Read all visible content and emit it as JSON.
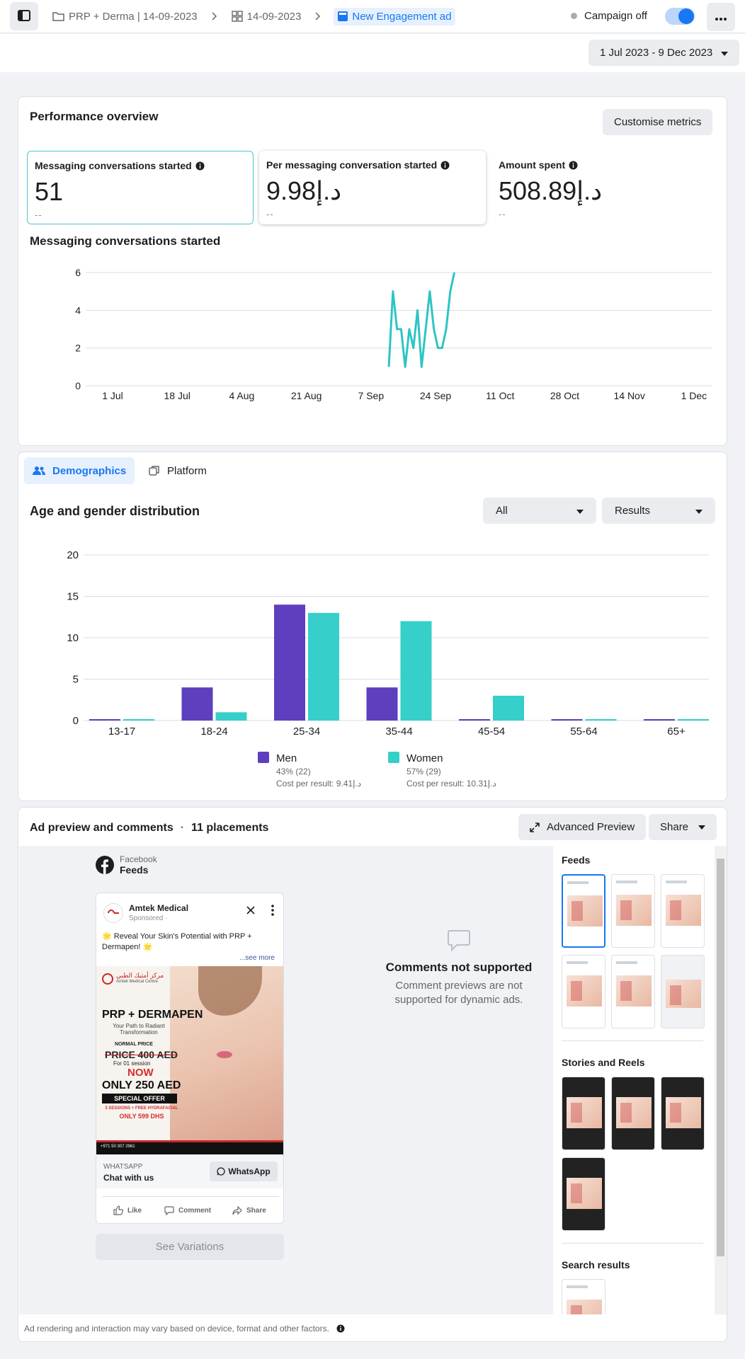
{
  "topbar": {
    "breadcrumbs": [
      "PRP + Derma | 14-09-2023",
      "14-09-2023",
      "New Engagement ad"
    ],
    "status_label": "Campaign off",
    "toggle_on": true
  },
  "date_range": "1 Jul 2023 - 9 Dec 2023",
  "performance": {
    "title": "Performance overview",
    "customise_label": "Customise metrics",
    "metrics": [
      {
        "label": "Messaging conversations started",
        "value": "51",
        "compare": "--"
      },
      {
        "label": "Per messaging conversation started",
        "value": "د.إ9.98",
        "compare": "--"
      },
      {
        "label": "Amount spent",
        "value": "د.إ508.89",
        "compare": "--"
      }
    ],
    "chart_title": "Messaging conversations started"
  },
  "line_chart": {
    "type": "line",
    "title": "Messaging conversations started",
    "x_tick_labels": [
      "1 Jul",
      "18 Jul",
      "4 Aug",
      "21 Aug",
      "7 Sep",
      "24 Sep",
      "11 Oct",
      "28 Oct",
      "14 Nov",
      "1 Dec"
    ],
    "y_ticks": [
      0,
      2,
      4,
      6
    ],
    "ylim": [
      0,
      6
    ],
    "x_day_range": [
      0,
      153
    ],
    "x_days": [
      74,
      75,
      76,
      77,
      78,
      79,
      80,
      81,
      82,
      83,
      84,
      85,
      86,
      87,
      88,
      89,
      90
    ],
    "values": [
      1,
      5,
      3,
      3,
      1,
      3,
      2,
      4,
      1,
      3,
      5,
      3,
      2,
      2,
      3,
      5,
      6
    ],
    "color": "#2ec4c4"
  },
  "demographics": {
    "tabs": [
      "Demographics",
      "Platform"
    ],
    "title": "Age and gender distribution",
    "filter_all": "All",
    "filter_results": "Results",
    "legend": [
      {
        "name": "Men",
        "share": "43% (22)",
        "cpr": "Cost per result: 9.41د.إ"
      },
      {
        "name": "Women",
        "share": "57% (29)",
        "cpr": "Cost per result: 10.31د.إ"
      }
    ]
  },
  "chart_data": {
    "type": "bar",
    "title": "Age and gender distribution",
    "categories": [
      "13-17",
      "18-24",
      "25-34",
      "35-44",
      "45-54",
      "55-64",
      "65+"
    ],
    "series": [
      {
        "name": "Men",
        "values": [
          0,
          4,
          14,
          4,
          0,
          0,
          0
        ],
        "color": "#5e3fbe"
      },
      {
        "name": "Women",
        "values": [
          0,
          1,
          13,
          12,
          3,
          0,
          0
        ],
        "color": "#36cfc9"
      }
    ],
    "y_ticks": [
      0,
      5,
      10,
      15,
      20
    ],
    "ylim": [
      0,
      20
    ],
    "legend_position": "bottom"
  },
  "ad_preview": {
    "title": "Ad preview and comments",
    "placements_count": "11 placements",
    "advanced_label": "Advanced Preview",
    "share_label": "Share",
    "platform": "Facebook",
    "placement": "Feeds",
    "post": {
      "page_name": "Amtek Medical",
      "sponsored": "Sponsored · ",
      "text": "🌟 Reveal Your Skin's Potential with PRP + Dermapen! 🌟",
      "see_more": "...see more",
      "creative": {
        "brand_ar": "مركز أمتيك الطبي",
        "brand_en": "Amtek Medical Centre",
        "headline": "PRP + DERMAPEN",
        "subline": "Your Path to Radiant Transformation",
        "normal_price": "NORMAL PRICE",
        "old_price": "PRICE 400 AED",
        "old_note": "For 01 session",
        "now": "NOW",
        "new_price": "ONLY 250 AED",
        "offer": "SPECIAL OFFER",
        "bundle": "3 SESSIONS + FREE HYDRAFACIAL",
        "bundle_price": "ONLY 599 DHS",
        "phone": "+971 50 307 2961"
      },
      "cta_source": "WHATSAPP",
      "cta_text": "Chat with us",
      "cta_button": "WhatsApp",
      "actions": [
        "Like",
        "Comment",
        "Share"
      ]
    },
    "variations_label": "See Variations",
    "comments_title": "Comments not supported",
    "comments_desc": "Comment previews are not supported for dynamic ads.",
    "sections": [
      "Feeds",
      "Stories and Reels",
      "Search results"
    ],
    "footer": "Ad rendering and interaction may vary based on device, format and other factors."
  }
}
